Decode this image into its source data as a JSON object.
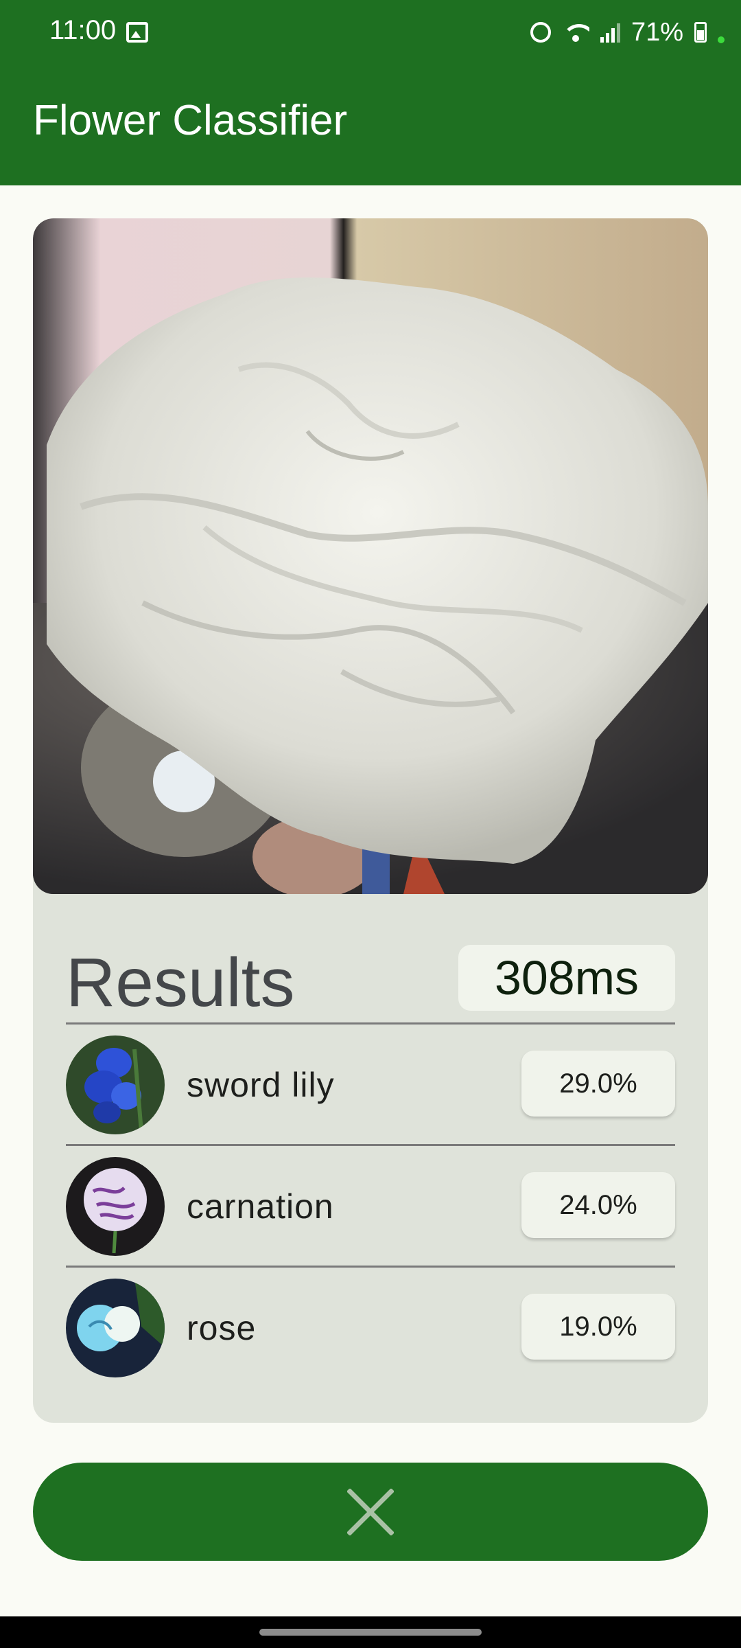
{
  "status_bar": {
    "time": "11:00",
    "battery": "71%",
    "icons": [
      "gallery-icon",
      "alarm-icon",
      "wifi-icon",
      "signal-icon",
      "battery-icon"
    ]
  },
  "app_bar": {
    "title": "Flower Classifier"
  },
  "results": {
    "title": "Results",
    "inference_time": "308ms",
    "items": [
      {
        "label": "sword lily",
        "score": "29.0%"
      },
      {
        "label": "carnation",
        "score": "24.0%"
      },
      {
        "label": "rose",
        "score": "19.0%"
      }
    ]
  },
  "actions": {
    "close_icon": "close-icon"
  },
  "colors": {
    "primary": "#1e7021",
    "surface": "#fafbf5",
    "card": "#dfe3da",
    "badge": "#f1f4ec"
  }
}
